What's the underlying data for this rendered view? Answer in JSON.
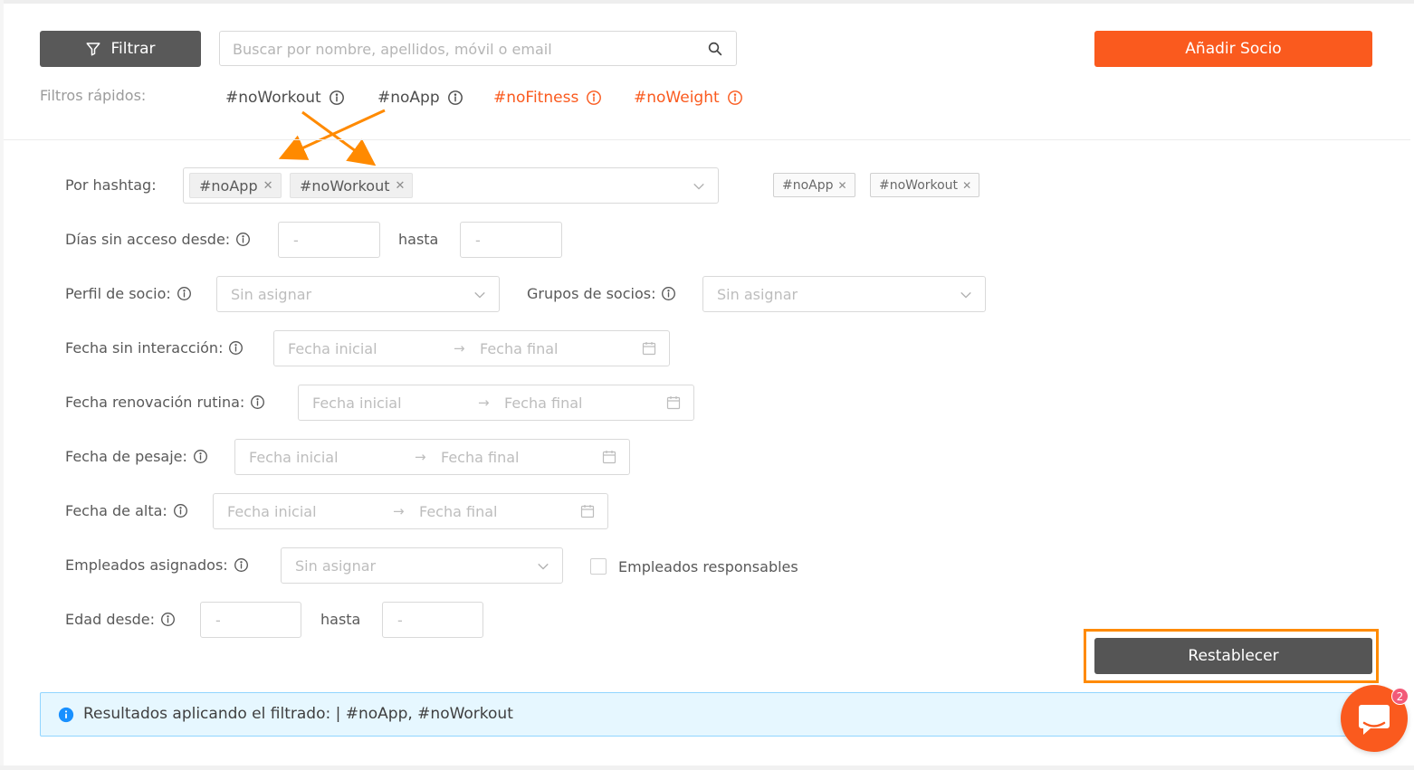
{
  "toolbar": {
    "filter_label": "Filtrar",
    "search_placeholder": "Buscar por nombre, apellidos, móvil o email",
    "add_member_label": "Añadir Socio"
  },
  "quick_filters": {
    "label": "Filtros rápidos:",
    "tags": [
      {
        "label": "#noWorkout",
        "color": "#4d4d4d"
      },
      {
        "label": "#noApp",
        "color": "#4d4d4d"
      },
      {
        "label": "#noFitness",
        "color": "#fa5a1e"
      },
      {
        "label": "#noWeight",
        "color": "#fa5a1e"
      }
    ]
  },
  "form": {
    "hashtag": {
      "label": "Por hashtag:",
      "selected": [
        "#noApp",
        "#noWorkout"
      ],
      "pills": [
        "#noApp",
        "#noWorkout"
      ]
    },
    "days_no_access": {
      "label": "Días sin acceso desde:",
      "from_placeholder": "-",
      "until_label": "hasta",
      "to_placeholder": "-"
    },
    "member_profile": {
      "label": "Perfil de socio:",
      "placeholder": "Sin asignar"
    },
    "member_groups": {
      "label": "Grupos de socios:",
      "placeholder": "Sin asignar"
    },
    "date_no_interaction": {
      "label": "Fecha sin interacción:",
      "start": "Fecha inicial",
      "end": "Fecha final"
    },
    "date_routine_renewal": {
      "label": "Fecha renovación rutina:",
      "start": "Fecha inicial",
      "end": "Fecha final"
    },
    "date_weighing": {
      "label": "Fecha de pesaje:",
      "start": "Fecha inicial",
      "end": "Fecha final"
    },
    "date_signup": {
      "label": "Fecha de alta:",
      "start": "Fecha inicial",
      "end": "Fecha final"
    },
    "assigned_employees": {
      "label": "Empleados asignados:",
      "placeholder": "Sin asignar"
    },
    "responsible_employees": {
      "label": "Empleados responsables",
      "checked": false
    },
    "age": {
      "label": "Edad desde:",
      "from_placeholder": "-",
      "until_label": "hasta",
      "to_placeholder": "-"
    }
  },
  "reset_label": "Restablecer",
  "alert": {
    "text": "Resultados aplicando el filtrado: | #noApp, #noWorkout"
  },
  "chat": {
    "badge_count": "2"
  },
  "colors": {
    "accent": "#fa5a1e",
    "dark_button": "#595959",
    "highlight": "#ff8a00",
    "info_bg": "#e6f7ff",
    "info_border": "#91d5ff"
  }
}
